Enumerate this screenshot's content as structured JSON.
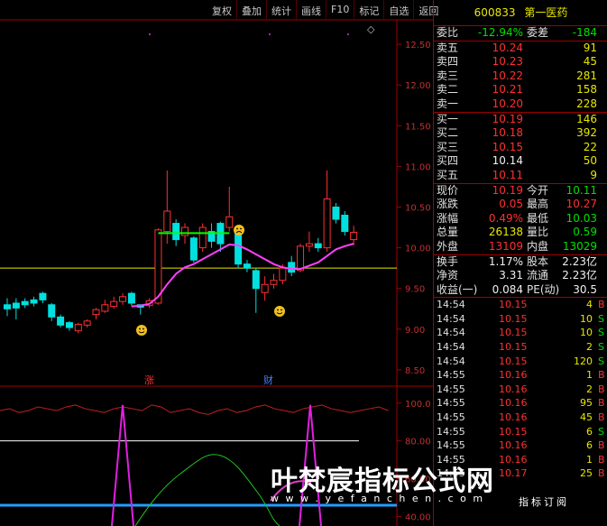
{
  "toolbar": [
    "复权",
    "叠加",
    "统计",
    "画线",
    "F10",
    "标记",
    "自选",
    "返回"
  ],
  "header": {
    "code": "600833",
    "name": "第一医药"
  },
  "weibi": {
    "label1": "委比",
    "value1": "-12.94%",
    "label2": "委差",
    "value2": "-184"
  },
  "asks": [
    {
      "label": "卖五",
      "price": "10.24",
      "vol": "91"
    },
    {
      "label": "卖四",
      "price": "10.23",
      "vol": "45"
    },
    {
      "label": "卖三",
      "price": "10.22",
      "vol": "281"
    },
    {
      "label": "卖二",
      "price": "10.21",
      "vol": "158"
    },
    {
      "label": "卖一",
      "price": "10.20",
      "vol": "228"
    }
  ],
  "bids": [
    {
      "label": "买一",
      "price": "10.19",
      "vol": "146"
    },
    {
      "label": "买二",
      "price": "10.18",
      "vol": "392"
    },
    {
      "label": "买三",
      "price": "10.15",
      "vol": "22"
    },
    {
      "label": "买四",
      "price": "10.14",
      "vol": "50"
    },
    {
      "label": "买五",
      "price": "10.11",
      "vol": "9"
    }
  ],
  "quote": [
    {
      "l1": "现价",
      "v1": "10.19",
      "l2": "今开",
      "v2": "10.11",
      "c1": "red",
      "c2": "green"
    },
    {
      "l1": "涨跌",
      "v1": "0.05",
      "l2": "最高",
      "v2": "10.27",
      "c1": "red",
      "c2": "red"
    },
    {
      "l1": "涨幅",
      "v1": "0.49%",
      "l2": "最低",
      "v2": "10.03",
      "c1": "red",
      "c2": "green"
    },
    {
      "l1": "总量",
      "v1": "26138",
      "l2": "量比",
      "v2": "0.59",
      "c1": "yellow",
      "c2": "green"
    },
    {
      "l1": "外盘",
      "v1": "13109",
      "l2": "内盘",
      "v2": "13029",
      "c1": "red",
      "c2": "green"
    }
  ],
  "stats": [
    {
      "l1": "换手",
      "v1": "1.17%",
      "l2": "股本",
      "v2": "2.23亿"
    },
    {
      "l1": "净资",
      "v1": "3.31",
      "l2": "流通",
      "v2": "2.23亿"
    },
    {
      "l1": "收益(一)",
      "v1": "0.084",
      "l2": "PE(动)",
      "v2": "30.5"
    }
  ],
  "ticks": [
    {
      "t": "14:54",
      "p": "10.15",
      "v": "4",
      "d": "B"
    },
    {
      "t": "14:54",
      "p": "10.15",
      "v": "10",
      "d": "S"
    },
    {
      "t": "14:54",
      "p": "10.15",
      "v": "10",
      "d": "S"
    },
    {
      "t": "14:54",
      "p": "10.15",
      "v": "2",
      "d": "S"
    },
    {
      "t": "14:54",
      "p": "10.15",
      "v": "120",
      "d": "S"
    },
    {
      "t": "14:55",
      "p": "10.16",
      "v": "1",
      "d": "B"
    },
    {
      "t": "14:55",
      "p": "10.16",
      "v": "2",
      "d": "B"
    },
    {
      "t": "14:55",
      "p": "10.16",
      "v": "95",
      "d": "B"
    },
    {
      "t": "14:55",
      "p": "10.16",
      "v": "45",
      "d": "B"
    },
    {
      "t": "14:55",
      "p": "10.15",
      "v": "6",
      "d": "S"
    },
    {
      "t": "14:55",
      "p": "10.16",
      "v": "6",
      "d": "B"
    },
    {
      "t": "14:55",
      "p": "10.16",
      "v": "1",
      "d": "B"
    },
    {
      "t": "14:55",
      "p": "10.17",
      "v": "25",
      "d": "B"
    }
  ],
  "price_axis": [
    "12.50",
    "12.00",
    "11.50",
    "11.00",
    "10.50",
    "10.00",
    "9.50",
    "9.00",
    "8.50"
  ],
  "osc_axis": [
    "100.0",
    "80.00",
    "60.00",
    "40.00"
  ],
  "markers": {
    "zhang": "涨",
    "cai": "财",
    "diamond": "◇"
  },
  "watermark": {
    "title": "叶梵宸指标公式网",
    "url": "w w w . y e f a n c h e n . c o m",
    "sub": "指标订阅"
  },
  "colors": {
    "up": "#ff3030",
    "down": "#00e0e0",
    "ma": "#ff40ff",
    "flat": "#00ff00"
  },
  "chart_data": {
    "type": "candlestick",
    "ylim": [
      8.3,
      12.8
    ],
    "candles": [
      {
        "o": 9.3,
        "c": 9.25,
        "h": 9.38,
        "l": 9.16
      },
      {
        "o": 9.32,
        "c": 9.26,
        "h": 9.38,
        "l": 9.12
      },
      {
        "o": 9.34,
        "c": 9.3,
        "h": 9.38,
        "l": 9.26
      },
      {
        "o": 9.36,
        "c": 9.32,
        "h": 9.4,
        "l": 9.28
      },
      {
        "o": 9.44,
        "c": 9.36,
        "h": 9.46,
        "l": 9.32
      },
      {
        "o": 9.3,
        "c": 9.15,
        "h": 9.32,
        "l": 9.1
      },
      {
        "o": 9.15,
        "c": 9.05,
        "h": 9.18,
        "l": 9.02
      },
      {
        "o": 9.08,
        "c": 9.02,
        "h": 9.1,
        "l": 8.98
      },
      {
        "o": 8.98,
        "c": 9.06,
        "h": 9.08,
        "l": 8.95
      },
      {
        "o": 9.05,
        "c": 9.1,
        "h": 9.12,
        "l": 9.02
      },
      {
        "o": 9.18,
        "c": 9.24,
        "h": 9.26,
        "l": 9.12
      },
      {
        "o": 9.22,
        "c": 9.3,
        "h": 9.36,
        "l": 9.2
      },
      {
        "o": 9.28,
        "c": 9.34,
        "h": 9.4,
        "l": 9.25
      },
      {
        "o": 9.34,
        "c": 9.4,
        "h": 9.44,
        "l": 9.3
      },
      {
        "o": 9.44,
        "c": 9.32,
        "h": 9.46,
        "l": 9.28
      },
      {
        "o": 9.3,
        "c": 9.27,
        "h": 9.3,
        "l": 9.18
      },
      {
        "o": 9.29,
        "c": 9.35,
        "h": 9.38,
        "l": 9.26
      },
      {
        "o": 9.32,
        "c": 10.22,
        "h": 10.24,
        "l": 9.3
      },
      {
        "o": 10.2,
        "c": 10.45,
        "h": 10.95,
        "l": 10.05
      },
      {
        "o": 10.3,
        "c": 10.1,
        "h": 10.35,
        "l": 10.02
      },
      {
        "o": 10.15,
        "c": 10.25,
        "h": 10.3,
        "l": 10.05
      },
      {
        "o": 10.12,
        "c": 9.85,
        "h": 10.14,
        "l": 9.82
      },
      {
        "o": 10.0,
        "c": 10.25,
        "h": 10.3,
        "l": 9.95
      },
      {
        "o": 10.2,
        "c": 10.08,
        "h": 10.3,
        "l": 10.0
      },
      {
        "o": 10.3,
        "c": 10.05,
        "h": 10.32,
        "l": 9.95
      },
      {
        "o": 10.25,
        "c": 10.38,
        "h": 10.75,
        "l": 10.2
      },
      {
        "o": 10.18,
        "c": 9.8,
        "h": 10.2,
        "l": 9.75
      },
      {
        "o": 9.8,
        "c": 9.75,
        "h": 9.85,
        "l": 9.7
      },
      {
        "o": 9.72,
        "c": 9.5,
        "h": 9.75,
        "l": 9.2
      },
      {
        "o": 9.45,
        "c": 9.55,
        "h": 9.65,
        "l": 9.35
      },
      {
        "o": 9.55,
        "c": 9.6,
        "h": 9.68,
        "l": 9.5
      },
      {
        "o": 9.6,
        "c": 9.75,
        "h": 9.8,
        "l": 9.55
      },
      {
        "o": 9.82,
        "c": 9.7,
        "h": 9.9,
        "l": 9.65
      },
      {
        "o": 9.72,
        "c": 10.02,
        "h": 10.05,
        "l": 9.7
      },
      {
        "o": 10.02,
        "c": 10.05,
        "h": 10.2,
        "l": 9.95
      },
      {
        "o": 10.05,
        "c": 10.0,
        "h": 10.12,
        "l": 9.95
      },
      {
        "o": 10.0,
        "c": 10.6,
        "h": 10.95,
        "l": 9.95
      },
      {
        "o": 10.5,
        "c": 10.35,
        "h": 10.55,
        "l": 10.3
      },
      {
        "o": 10.4,
        "c": 10.2,
        "h": 10.45,
        "l": 10.15
      },
      {
        "o": 10.1,
        "c": 10.19,
        "h": 10.27,
        "l": 10.03
      }
    ],
    "ma": [
      null,
      null,
      null,
      null,
      null,
      null,
      null,
      null,
      null,
      null,
      null,
      null,
      null,
      null,
      9.28,
      9.29,
      9.31,
      9.4,
      9.55,
      9.68,
      9.76,
      9.8,
      9.86,
      9.92,
      9.98,
      10.04,
      10.03,
      9.98,
      9.92,
      9.86,
      9.8,
      9.76,
      9.74,
      9.74,
      9.78,
      9.82,
      9.9,
      9.98,
      10.02,
      10.05
    ],
    "flat_line": {
      "value": 10.18,
      "from": 17,
      "to": 25
    },
    "hline": 9.75,
    "osc": {
      "red": [
        96,
        97,
        95,
        96,
        98,
        97,
        96,
        98,
        99,
        97,
        96,
        95,
        97,
        98,
        97,
        96,
        99,
        98,
        95,
        96,
        97,
        95,
        94,
        96,
        97,
        95,
        96,
        98,
        99,
        97,
        96,
        95,
        97,
        98,
        99,
        97,
        96,
        95,
        96,
        97,
        98,
        96
      ],
      "white_level": 80,
      "blue_level": 46,
      "ylim": [
        35,
        108
      ]
    }
  }
}
